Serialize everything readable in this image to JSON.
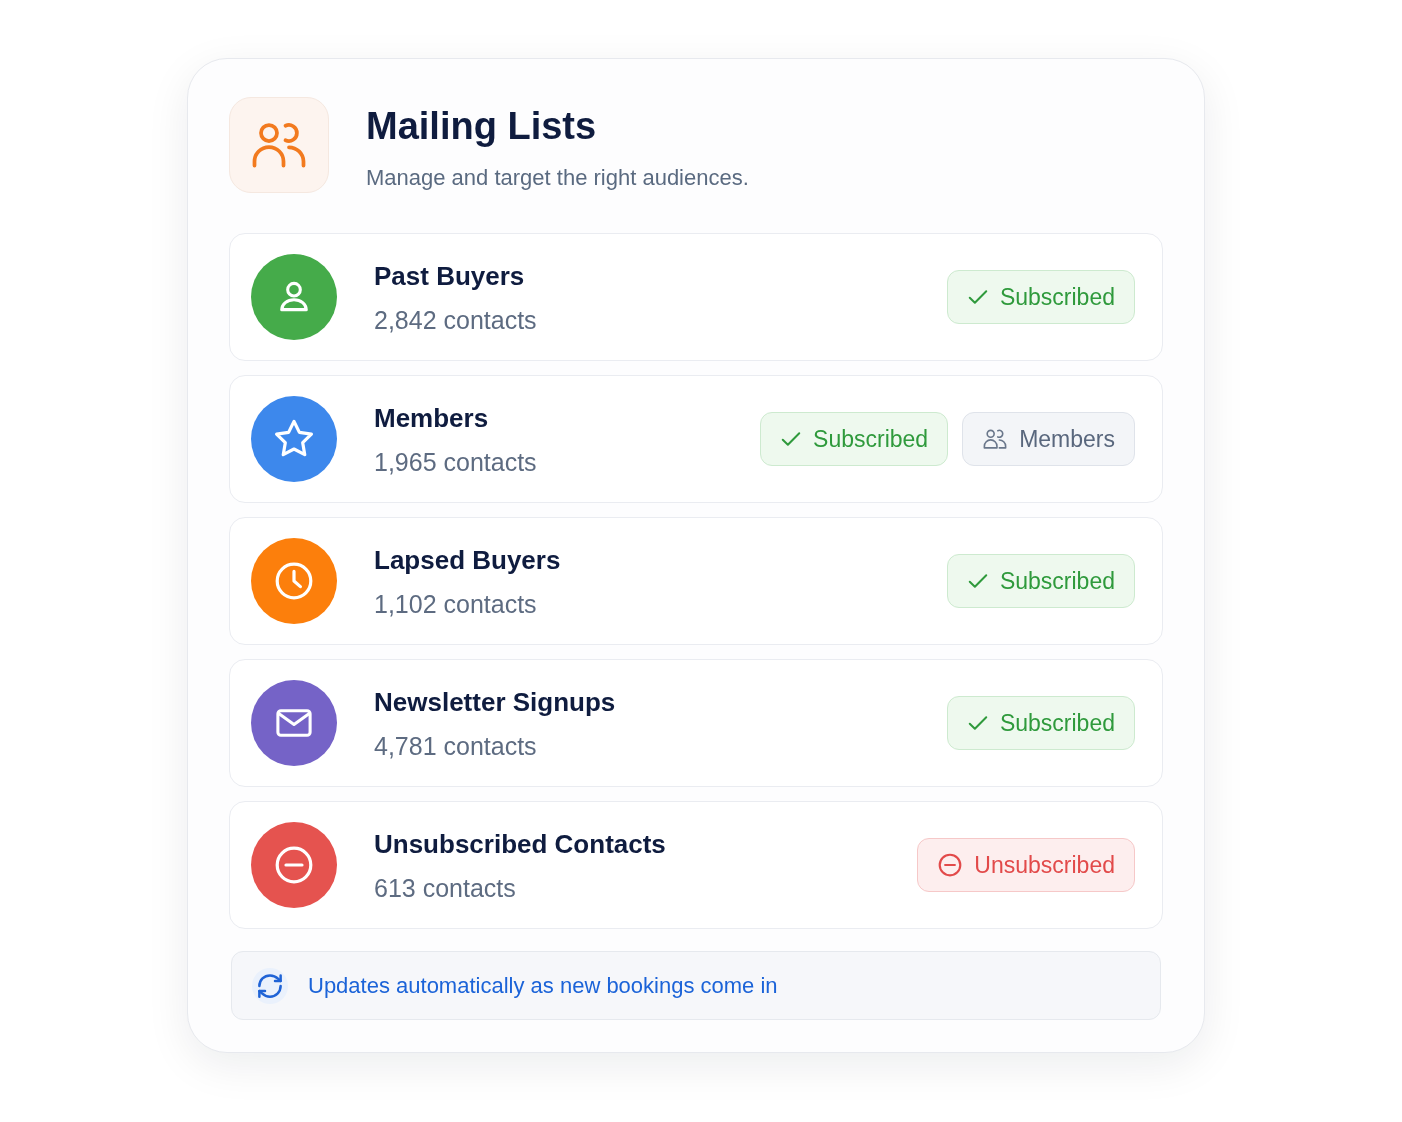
{
  "header": {
    "title": "Mailing Lists",
    "subtitle": "Manage and target the right audiences."
  },
  "lists": [
    {
      "name": "Past Buyers",
      "count": "2,842 contacts",
      "color": "#45ab4a",
      "badges": [
        {
          "kind": "subscribed",
          "label": "Subscribed"
        }
      ]
    },
    {
      "name": "Members",
      "count": "1,965 contacts",
      "color": "#3d88ec",
      "badges": [
        {
          "kind": "subscribed",
          "label": "Subscribed"
        },
        {
          "kind": "members",
          "label": "Members"
        }
      ]
    },
    {
      "name": "Lapsed Buyers",
      "count": "1,102 contacts",
      "color": "#fc7f0c",
      "badges": [
        {
          "kind": "subscribed",
          "label": "Subscribed"
        }
      ]
    },
    {
      "name": "Newsletter Signups",
      "count": "4,781 contacts",
      "color": "#7563c7",
      "badges": [
        {
          "kind": "subscribed",
          "label": "Subscribed"
        }
      ]
    },
    {
      "name": "Unsubscribed Contacts",
      "count": "613 contacts",
      "color": "#e5534f",
      "badges": [
        {
          "kind": "unsubscribed",
          "label": "Unsubscribed"
        }
      ]
    }
  ],
  "footer": {
    "text": "Updates automatically as new bookings come in"
  }
}
